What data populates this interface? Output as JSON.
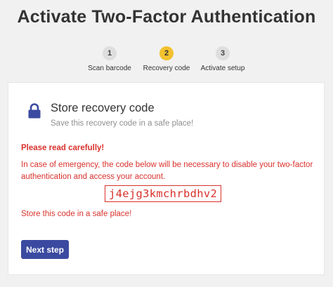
{
  "page": {
    "title": "Activate Two-Factor Authentication"
  },
  "steps": [
    {
      "number": "1",
      "label": "Scan barcode",
      "active": false
    },
    {
      "number": "2",
      "label": "Recovery code",
      "active": true
    },
    {
      "number": "3",
      "label": "Activate setup",
      "active": false
    }
  ],
  "card": {
    "icon": "lock-icon",
    "title": "Store recovery code",
    "subtitle": "Save this recovery code in a safe place!",
    "warning_title": "Please read carefully!",
    "warning_text": "In case of emergency, the code below will be necessary to disable your two-factor authentication and access your account.",
    "recovery_code": "j4ejg3kmchrbdhv2",
    "store_text": "Store this code in a safe place!",
    "next_button": "Next step"
  },
  "colors": {
    "accent": "#3b4aa0",
    "warning": "#d9312c",
    "active_step": "#f2c12e"
  }
}
